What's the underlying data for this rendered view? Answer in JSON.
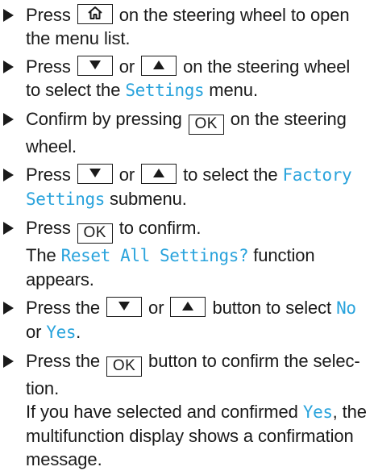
{
  "steps": [
    {
      "segments": [
        {
          "t": "text",
          "v": "Press "
        },
        {
          "t": "key",
          "icon": "home-icon"
        },
        {
          "t": "text",
          "v": " on the steering wheel to open the menu list."
        }
      ]
    },
    {
      "segments": [
        {
          "t": "text",
          "v": "Press "
        },
        {
          "t": "key",
          "icon": "triangle-down-icon"
        },
        {
          "t": "text",
          "v": " or "
        },
        {
          "t": "key",
          "icon": "triangle-up-icon"
        },
        {
          "t": "text",
          "v": " on the steering wheel to select the "
        },
        {
          "t": "display",
          "v": "Settings"
        },
        {
          "t": "text",
          "v": " menu."
        }
      ]
    },
    {
      "segments": [
        {
          "t": "text",
          "v": "Confirm by pressing "
        },
        {
          "t": "key",
          "v": "OK"
        },
        {
          "t": "text",
          "v": " on the steering wheel."
        }
      ]
    },
    {
      "segments": [
        {
          "t": "text",
          "v": "Press "
        },
        {
          "t": "key",
          "icon": "triangle-down-icon"
        },
        {
          "t": "text",
          "v": " or "
        },
        {
          "t": "key",
          "icon": "triangle-up-icon"
        },
        {
          "t": "text",
          "v": " to select the "
        },
        {
          "t": "display",
          "v": "Factory Settings"
        },
        {
          "t": "text",
          "v": " submenu."
        }
      ]
    },
    {
      "segments": [
        {
          "t": "text",
          "v": "Press "
        },
        {
          "t": "key",
          "v": "OK"
        },
        {
          "t": "text",
          "v": " to confirm."
        },
        {
          "t": "br"
        },
        {
          "t": "text",
          "v": "The "
        },
        {
          "t": "display",
          "v": "Reset All Settings?"
        },
        {
          "t": "text",
          "v": " function appears."
        }
      ]
    },
    {
      "segments": [
        {
          "t": "text",
          "v": "Press the "
        },
        {
          "t": "key",
          "icon": "triangle-down-icon"
        },
        {
          "t": "text",
          "v": " or "
        },
        {
          "t": "key",
          "icon": "triangle-up-icon"
        },
        {
          "t": "text",
          "v": " button to select "
        },
        {
          "t": "display",
          "v": "No"
        },
        {
          "t": "text",
          "v": " or "
        },
        {
          "t": "display",
          "v": "Yes"
        },
        {
          "t": "text",
          "v": "."
        }
      ]
    },
    {
      "segments": [
        {
          "t": "text",
          "v": "Press the "
        },
        {
          "t": "key",
          "v": "OK"
        },
        {
          "t": "text",
          "v": " button to confirm the selec­tion."
        },
        {
          "t": "br"
        },
        {
          "t": "text",
          "v": "If you have selected and confirmed "
        },
        {
          "t": "display",
          "v": "Yes"
        },
        {
          "t": "text",
          "v": ", the multifunction display shows a confirmation message."
        }
      ]
    }
  ],
  "colors": {
    "display_text": "#29a3dc",
    "body_text": "#1a1a1a"
  }
}
